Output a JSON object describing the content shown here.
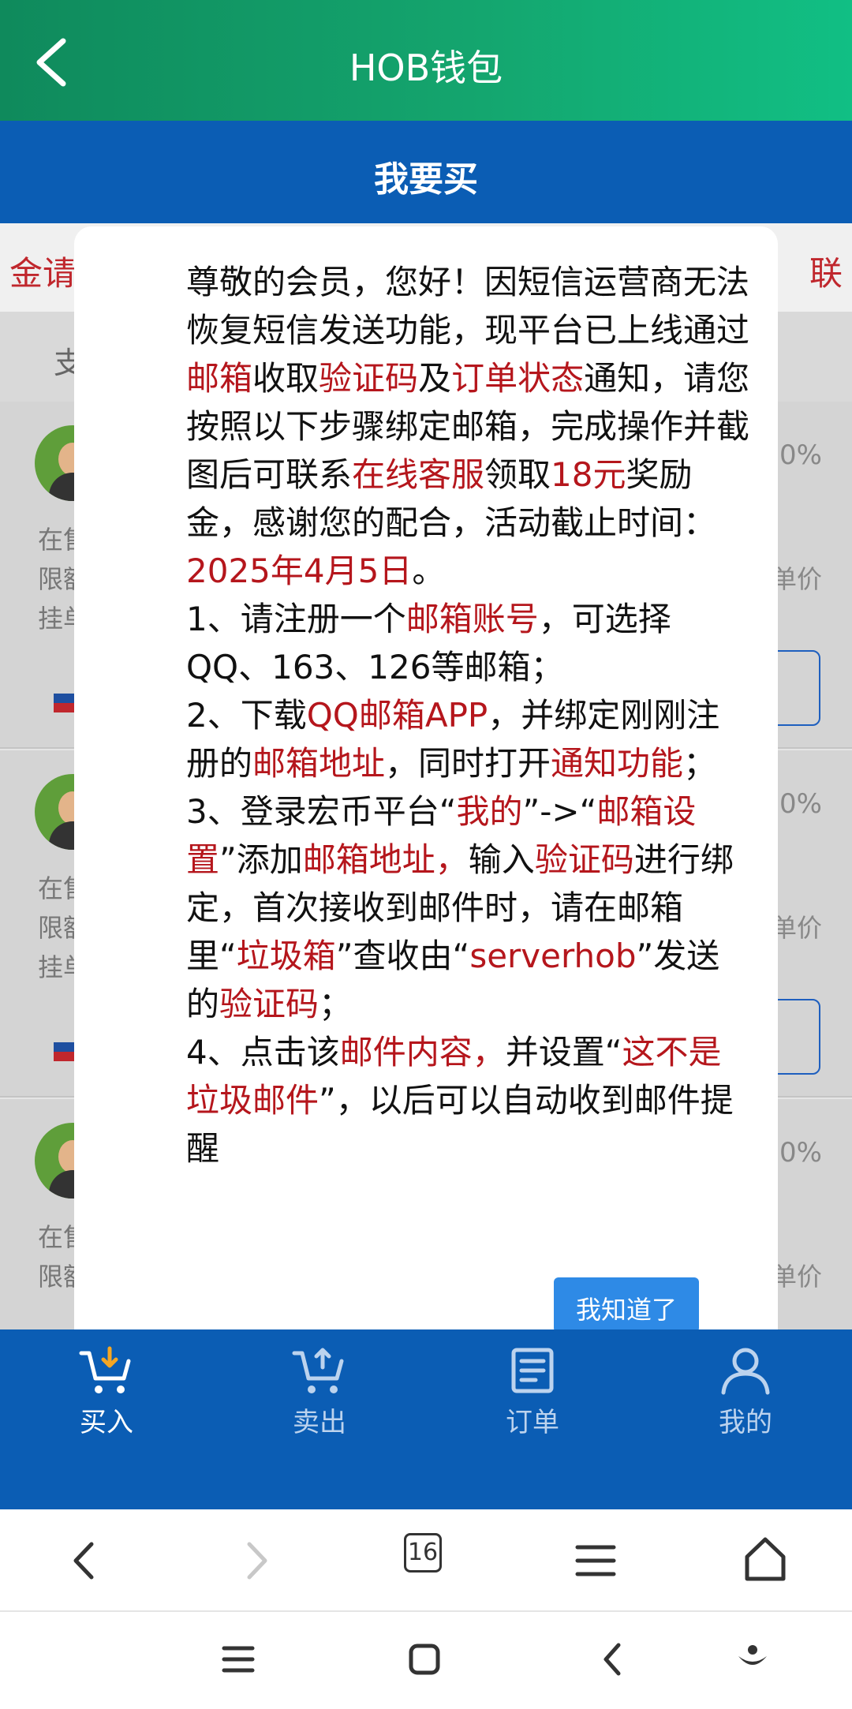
{
  "header": {
    "title": "HOB钱包"
  },
  "subbar": {
    "tab": "我要买"
  },
  "strip": {
    "left": "金请",
    "right": "联"
  },
  "filter": {
    "label": "支"
  },
  "cards": [
    {
      "info1": "在售",
      "info2": "限额",
      "info3": "挂单",
      "pct": "0%",
      "unit": "单价"
    },
    {
      "info1": "在售",
      "info2": "限额",
      "info3": "挂单",
      "pct": "0%",
      "unit": "单价"
    },
    {
      "info1": "在售",
      "info2": "限额",
      "pct": "0%",
      "unit": "单价"
    }
  ],
  "modal": {
    "p1": [
      "尊敬的会员，您好！因短信运营商无法恢复短信发送功能，现平台已上线通过",
      "邮箱",
      "收取",
      "验证码",
      "及",
      "订单状态",
      "通知，请您按照以下步骤绑定邮箱，完成操作并截图后可联系",
      "在线客服",
      "领取",
      "18元",
      "奖励金，感谢您的配合，活动截止时间：",
      "2025年4月5日",
      "。"
    ],
    "p2": [
      "1、请注册一个",
      "邮箱账号",
      "，可选择QQ、163、126等邮箱；"
    ],
    "p3": [
      "2、下载",
      "QQ邮箱APP",
      "，并绑定刚刚注册的",
      "邮箱地址",
      "，同时打开",
      "通知功能",
      "；"
    ],
    "p4": [
      "3、登录宏币平台“",
      "我的",
      "”->“",
      "邮箱设置",
      "”添加",
      "邮箱地址，",
      "输入",
      "验证码",
      "进行绑定，首次接收到邮件时，请在邮箱里“",
      "垃圾箱",
      "”查收由“",
      "serverhob",
      "”发送的",
      "验证码",
      "；"
    ],
    "p5": [
      "4、点击该",
      "邮件内容，",
      "并设置“",
      "这不是垃圾邮件",
      "”，以后可以自动收到邮件提醒"
    ],
    "ok_button": "我知道了"
  },
  "tabbar": {
    "items": [
      {
        "label": "买入",
        "icon": "cart-download-icon"
      },
      {
        "label": "卖出",
        "icon": "cart-upload-icon"
      },
      {
        "label": "订单",
        "icon": "order-icon"
      },
      {
        "label": "我的",
        "icon": "user-icon"
      }
    ]
  },
  "browser": {
    "tab_count": "16"
  }
}
